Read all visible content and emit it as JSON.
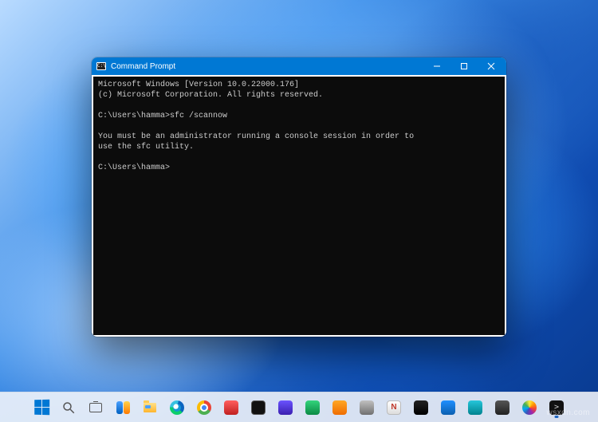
{
  "window": {
    "title": "Command Prompt",
    "console_output": "Microsoft Windows [Version 10.0.22000.176]\n(c) Microsoft Corporation. All rights reserved.\n\nC:\\Users\\hamma>sfc /scannow\n\nYou must be an administrator running a console session in order to\nuse the sfc utility.\n\nC:\\Users\\hamma>"
  },
  "taskbar": {
    "items": [
      {
        "name": "start",
        "label": "Start"
      },
      {
        "name": "search",
        "label": "Search"
      },
      {
        "name": "task-view",
        "label": "Task View"
      },
      {
        "name": "widgets",
        "label": "Widgets"
      },
      {
        "name": "file-explorer",
        "label": "File Explorer"
      },
      {
        "name": "edge",
        "label": "Microsoft Edge"
      },
      {
        "name": "chrome",
        "label": "Google Chrome"
      },
      {
        "name": "app-1",
        "label": "App"
      },
      {
        "name": "app-2",
        "label": "App"
      },
      {
        "name": "app-3",
        "label": "App"
      },
      {
        "name": "app-4",
        "label": "App"
      },
      {
        "name": "app-5",
        "label": "App"
      },
      {
        "name": "app-6",
        "label": "App"
      },
      {
        "name": "app-7",
        "label": "App"
      },
      {
        "name": "app-8",
        "label": "App"
      },
      {
        "name": "app-9",
        "label": "App"
      },
      {
        "name": "app-10",
        "label": "App"
      },
      {
        "name": "app-11",
        "label": "App"
      },
      {
        "name": "app-12",
        "label": "App"
      },
      {
        "name": "command-prompt",
        "label": "Command Prompt"
      }
    ]
  },
  "watermark": "wsxdn.com"
}
